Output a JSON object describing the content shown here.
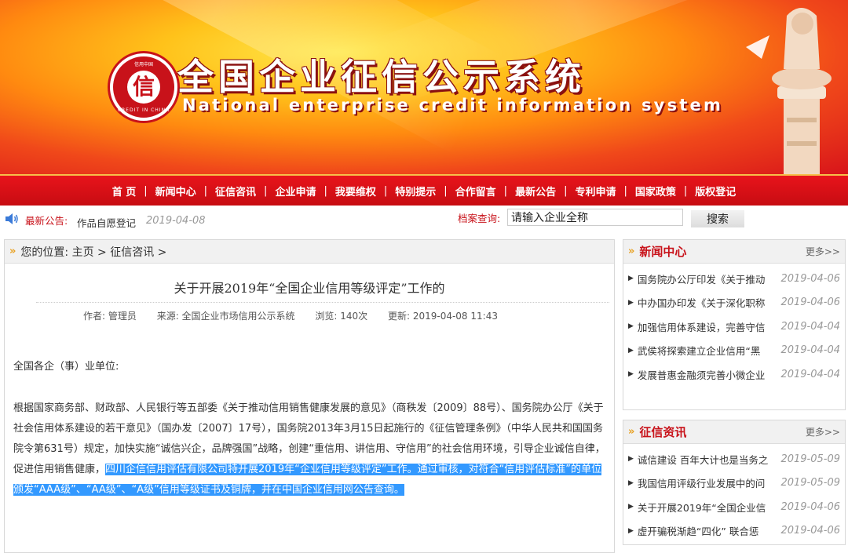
{
  "header": {
    "title": "全国企业征信公示系统",
    "subtitle": "National enterprise credit information system",
    "logo_char": "信",
    "logo_ring_top": "信用中国",
    "logo_ring_bottom": "CREDIT IN CHINA"
  },
  "nav": {
    "items": [
      "首 页",
      "新闻中心",
      "征信咨讯",
      "企业申请",
      "我要维权",
      "特别提示",
      "合作留言",
      "最新公告",
      "专利申请",
      "国家政策",
      "版权登记"
    ]
  },
  "bulletin": {
    "label": "最新公告:",
    "text": "作品自愿登记",
    "date": "2019-04-08",
    "search_label": "档案查询:",
    "search_value": "请输入企业全称",
    "search_button": "搜索"
  },
  "breadcrumb": {
    "text": "您的位置: 主页 > 征信咨讯 >"
  },
  "article": {
    "title": "关于开展2019年“全国企业信用等级评定”工作的",
    "author": "作者: 管理员",
    "source": "来源: 全国企业市场信用公示系统",
    "views": "浏览: 140次",
    "updated": "更新: 2019-04-08 11:43",
    "greeting": "全国各企（事）业单位:",
    "para_normal": "根据国家商务部、财政部、人民银行等五部委《关于推动信用销售健康发展的意见》（商秩发〔2009〕88号）、国务院办公厅《关于社会信用体系建设的若干意见》（国办发〔2007〕17号），国务院2013年3月15日起施行的《征信管理条例》（中华人民共和国国务院令第631号）规定，加快实施“诚信兴企，品牌强国”战略，创建“重信用、讲信用、守信用”的社会信用环境，引导企业诚信自律，促进信用销售健康，",
    "para_highlight": "四川企信信用评估有限公司特开展2019年“企业信用等级评定”工作。通过审核，对符合“信用评估标准”的单位颁发“AAA级”、“AA级”、“A级”信用等级证书及铜牌，并在中国企业信用网公告查询。"
  },
  "news_center": {
    "title": "新闻中心",
    "more": "更多>>",
    "items": [
      {
        "title": "国务院办公厅印发《关于推动",
        "date": "2019-04-06"
      },
      {
        "title": "中办国办印发《关于深化职称",
        "date": "2019-04-06"
      },
      {
        "title": "加强信用体系建设，完善守信",
        "date": "2019-04-04"
      },
      {
        "title": "武侯将探索建立企业信用“黑",
        "date": "2019-04-04"
      },
      {
        "title": "发展普惠金融须完善小微企业",
        "date": "2019-04-04"
      }
    ]
  },
  "credit_news": {
    "title": "征信资讯",
    "more": "更多>>",
    "items": [
      {
        "title": "诚信建设 百年大计也是当务之",
        "date": "2019-05-09"
      },
      {
        "title": "我国信用评级行业发展中的问",
        "date": "2019-05-09"
      },
      {
        "title": "关于开展2019年“全国企业信",
        "date": "2019-04-06"
      },
      {
        "title": "虚开骗税渐趋“四化” 联合惩",
        "date": "2019-04-06"
      }
    ]
  },
  "colors": {
    "brand_red": "#c8121a",
    "highlight": "#3399ff"
  }
}
